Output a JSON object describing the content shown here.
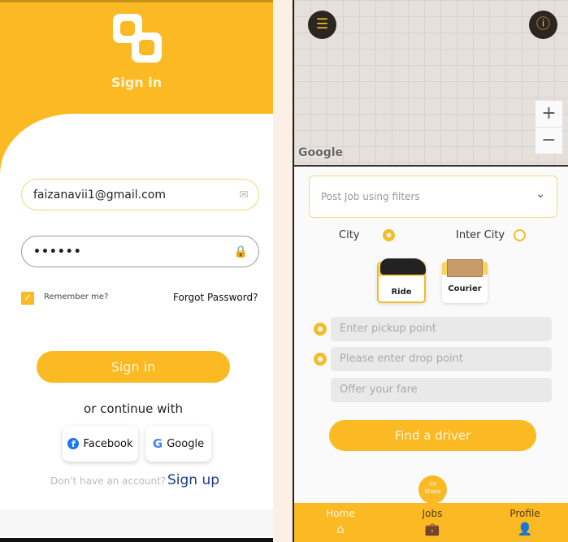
{
  "signin": {
    "title": "Sign in",
    "email_value": "faizanavii1@gmail.com",
    "password_value": "••••••",
    "remember_label": "Remember me?",
    "remember_checked": true,
    "forgot_label": "Forgot Password?",
    "signin_button": "Sign in",
    "or_continue": "or continue with",
    "facebook_label": "Facebook",
    "google_label": "Google",
    "no_account": "Don't have an account?",
    "signup_link": "Sign up"
  },
  "home": {
    "map_attribution": "Google",
    "zoom_in": "+",
    "zoom_out": "−",
    "post_job_placeholder": "Post Job using filters",
    "trip_types": [
      {
        "label": "City",
        "selected": true
      },
      {
        "label": "Inter City",
        "selected": false
      }
    ],
    "vehicles": [
      {
        "label": "Ride",
        "selected": true
      },
      {
        "label": "Courier",
        "selected": false
      }
    ],
    "pickup_placeholder": "Enter pickup point",
    "drop_placeholder": "Please enter drop point",
    "fare_placeholder": "Offer your fare",
    "find_button": "Find a driver",
    "share_label": "Share",
    "nav": [
      {
        "label": "Home",
        "icon": "home-icon",
        "active": true
      },
      {
        "label": "Jobs",
        "icon": "briefcase-icon"
      },
      {
        "label": "Profile",
        "icon": "user-icon"
      }
    ]
  },
  "colors": {
    "accent": "#fbb924",
    "dark": "#2b2620",
    "link": "#1e3a8a"
  }
}
